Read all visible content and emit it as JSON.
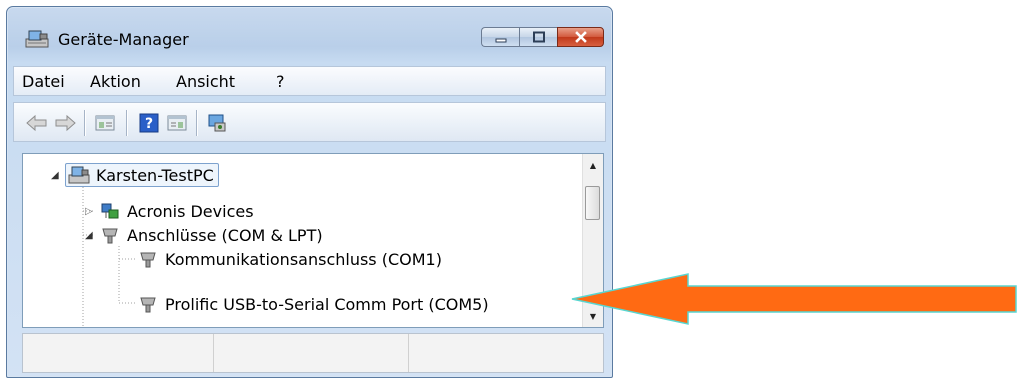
{
  "window": {
    "title": "Geräte-Manager",
    "title_icon": "device-manager-icon",
    "buttons": [
      "minimize-icon",
      "maximize-icon",
      "close-icon"
    ]
  },
  "menu": {
    "items": [
      {
        "label": "Datei"
      },
      {
        "label": "Aktion"
      },
      {
        "label": "Ansicht"
      },
      {
        "label": "?"
      }
    ]
  },
  "toolbar": {
    "buttons": [
      "back-arrow-icon",
      "forward-arrow-icon",
      "properties-icon",
      "help-icon",
      "view-icon",
      "scan-hardware-icon"
    ]
  },
  "tree": {
    "root": {
      "label": "Karsten-TestPC",
      "icon": "computer-icon",
      "expanded": true
    },
    "items": [
      {
        "label": "Acronis Devices",
        "icon": "network-device-icon",
        "expanded": false
      },
      {
        "label": "Anschlüsse (COM & LPT)",
        "icon": "port-icon",
        "expanded": true
      },
      {
        "label": "Kommunikationsanschluss (COM1)",
        "icon": "port-icon"
      },
      {
        "label": "Prolific USB-to-Serial Comm Port (COM5)",
        "icon": "port-icon"
      }
    ]
  },
  "annotation": {
    "arrow_color": "#ff6a13",
    "arrow_outline": "#59d6d0"
  }
}
